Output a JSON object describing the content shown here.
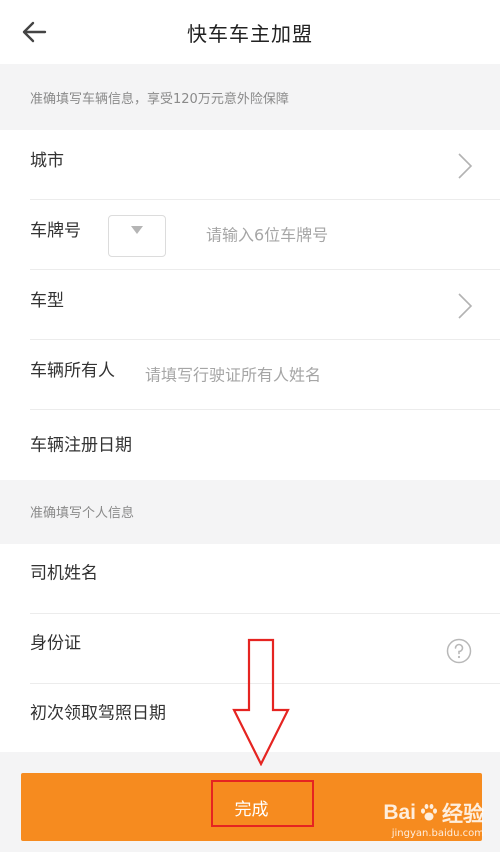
{
  "header": {
    "title": "快车车主加盟"
  },
  "vehicle_section": {
    "hint": "准确填写车辆信息，享受120万元意外险保障",
    "city_label": "城市",
    "plate_label": "车牌号",
    "plate_placeholder": "请输入6位车牌号",
    "model_label": "车型",
    "owner_label": "车辆所有人",
    "owner_placeholder": "请填写行驶证所有人姓名",
    "register_date_label": "车辆注册日期"
  },
  "personal_section": {
    "hint": "准确填写个人信息",
    "driver_name_label": "司机姓名",
    "id_card_label": "身份证",
    "license_date_label": "初次领取驾照日期"
  },
  "footer": {
    "submit_label": "完成"
  },
  "watermark": {
    "brand_prefix": "Bai",
    "brand_suffix": "经验",
    "url": "jingyan.baidu.com"
  },
  "colors": {
    "accent": "#f68b1f",
    "annotation": "#e52421"
  }
}
